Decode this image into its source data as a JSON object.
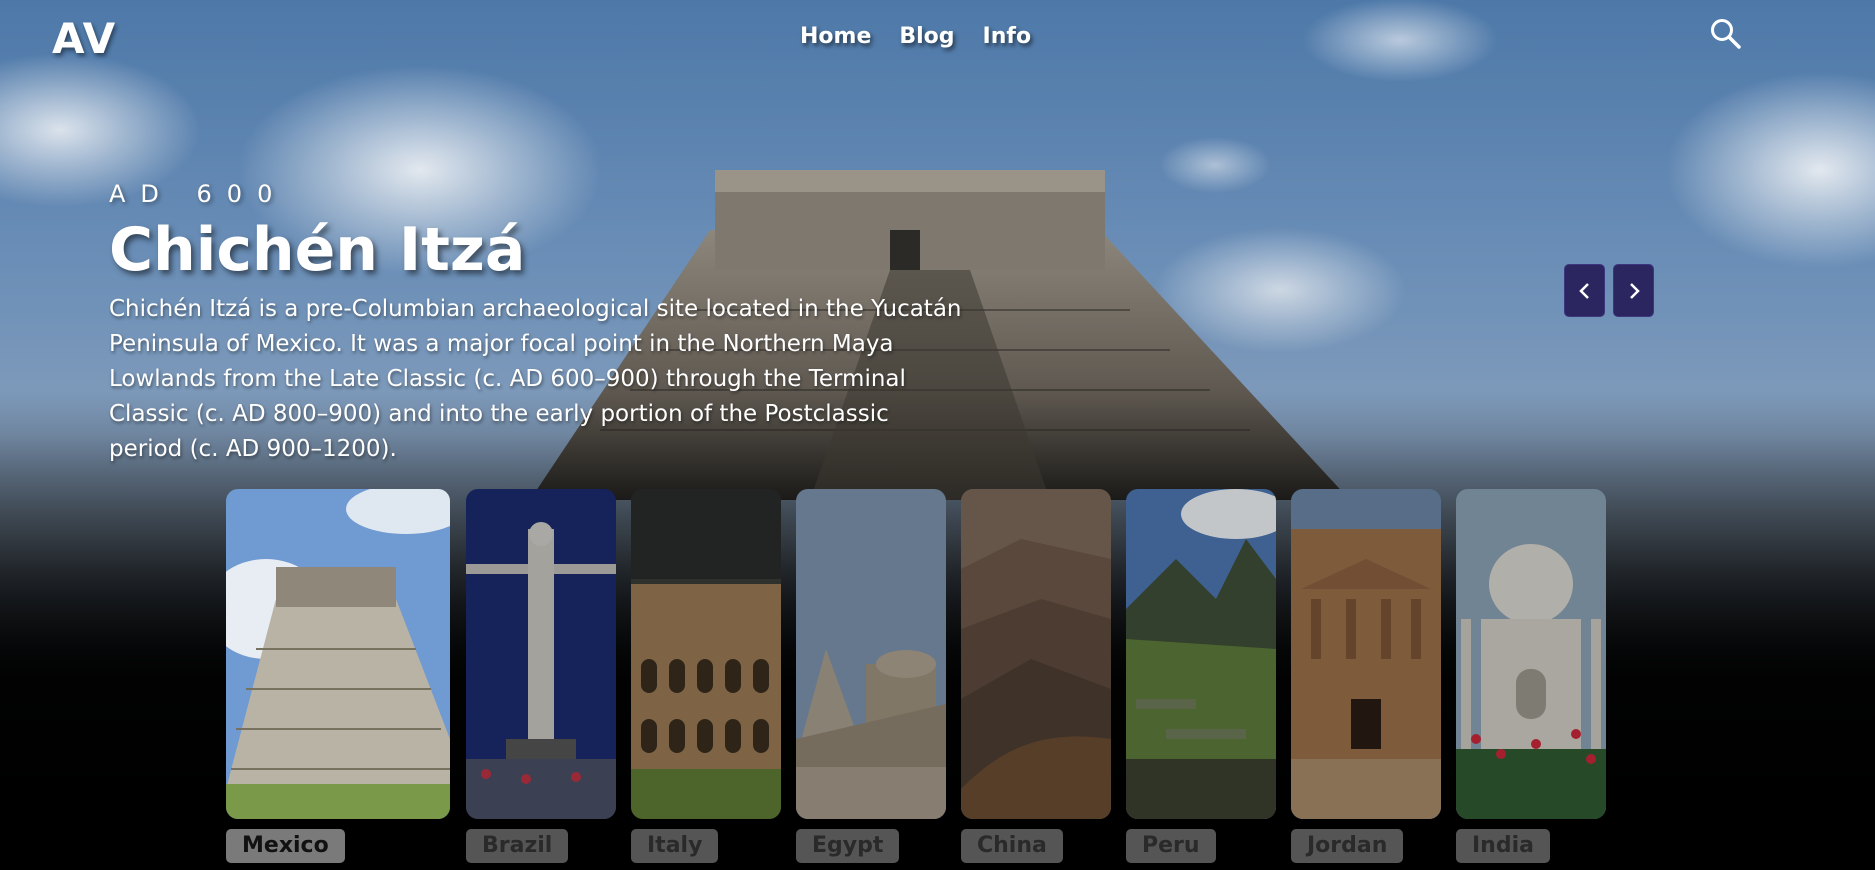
{
  "brand": {
    "logo": "AV"
  },
  "nav": {
    "links": [
      "Home",
      "Blog",
      "Info"
    ]
  },
  "icons": {
    "search": "search-icon",
    "prev": "chevron-left-icon",
    "next": "chevron-right-icon"
  },
  "hero": {
    "era": "AD 600",
    "title": "Chichén Itzá",
    "description": "Chichén Itzá is a pre-Columbian archaeological site located in the Yucatán Peninsula of Mexico. It was a major focal point in the Northern Maya Lowlands from the Late Classic (c. AD 600–900) through the Terminal Classic (c. AD 800–900) and into the early portion of the Postclassic period (c. AD 900–1200)."
  },
  "destinations": [
    {
      "country": "Mexico",
      "image": "chichen-itza-pyramid",
      "active": true
    },
    {
      "country": "Brazil",
      "image": "christ-the-redeemer",
      "active": false
    },
    {
      "country": "Italy",
      "image": "colosseum",
      "active": false
    },
    {
      "country": "Egypt",
      "image": "egypt-pyramid-ruins",
      "active": false
    },
    {
      "country": "China",
      "image": "great-wall",
      "active": false
    },
    {
      "country": "Peru",
      "image": "machu-picchu",
      "active": false
    },
    {
      "country": "Jordan",
      "image": "petra-treasury",
      "active": false
    },
    {
      "country": "India",
      "image": "taj-mahal",
      "active": false
    }
  ],
  "colors": {
    "accent_button": "#2b2560",
    "label_bg": "#555555"
  }
}
